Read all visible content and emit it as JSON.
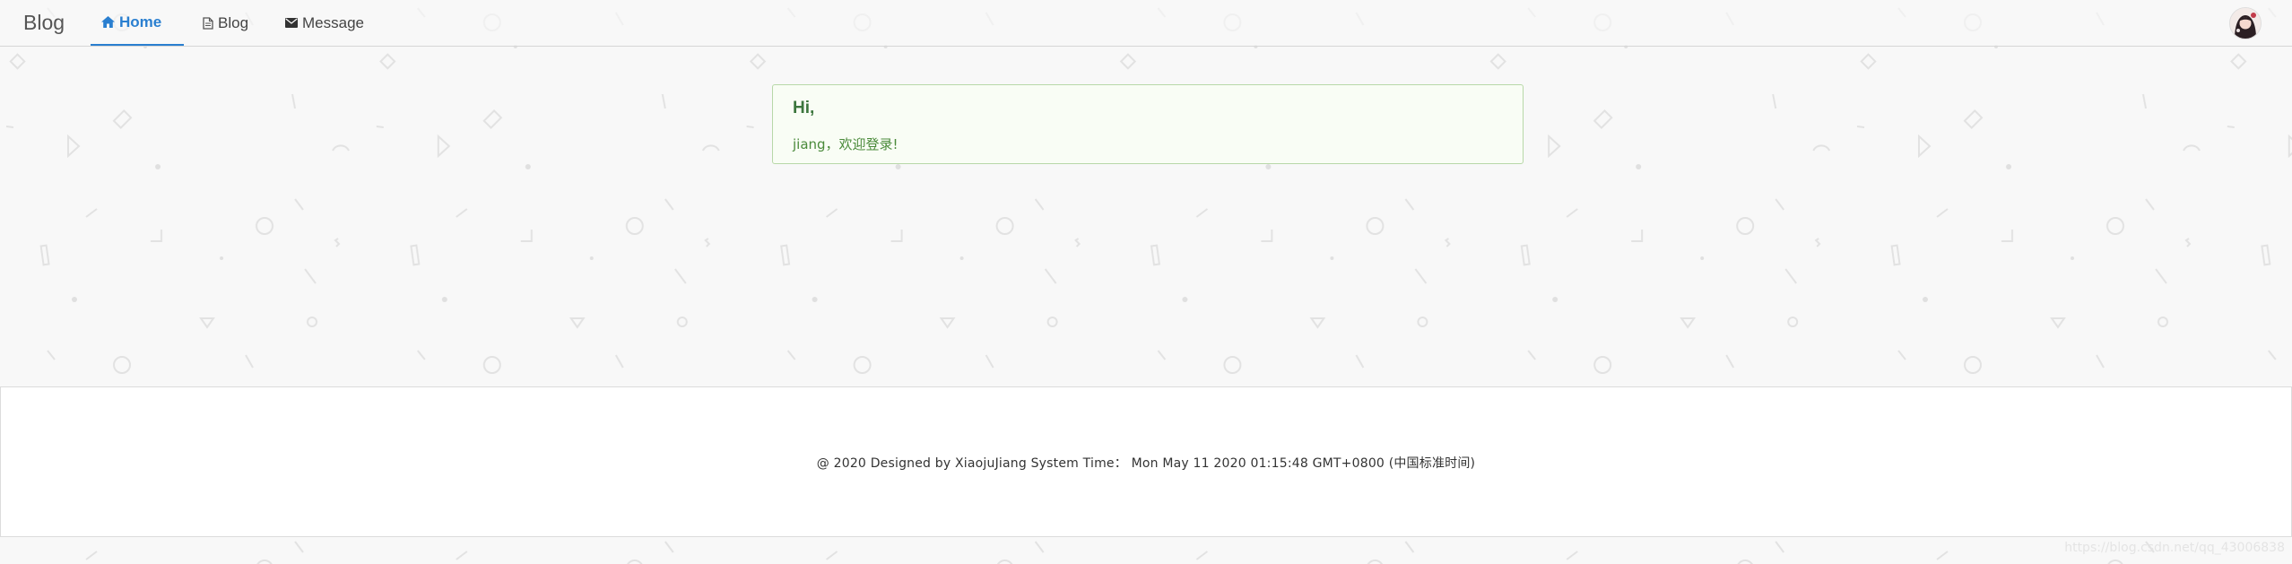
{
  "navbar": {
    "brand": "Blog",
    "items": [
      {
        "label": "Home",
        "icon": "home-icon",
        "active": true
      },
      {
        "label": "Blog",
        "icon": "file-icon",
        "active": false
      },
      {
        "label": "Message",
        "icon": "envelope-icon",
        "active": false
      }
    ],
    "avatar": "user-avatar"
  },
  "greeting": {
    "title": "Hi,",
    "message": "jiang，欢迎登录!"
  },
  "footer": {
    "text": "@ 2020 Designed by XiaojuJiang System Time： Mon May 11 2020 01:15:48 GMT+0800 (中国标准时间)"
  },
  "watermark": "https://blog.csdn.net/qq_43006838",
  "colors": {
    "accent": "#2a7fd0",
    "success_text": "#3c763d",
    "success_border": "#b8d8a8",
    "background": "#f8f8f8"
  }
}
